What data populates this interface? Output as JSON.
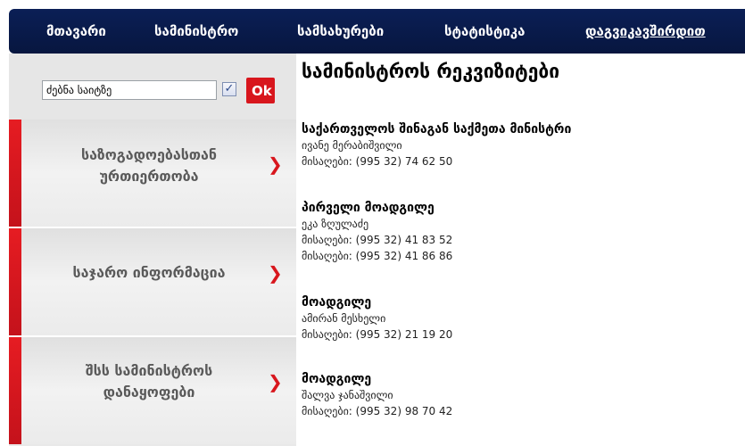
{
  "nav": {
    "items": [
      {
        "label": "მთავარი"
      },
      {
        "label": "სამინისტრო"
      },
      {
        "label": "სამსახურები"
      },
      {
        "label": "სტატისტიკა"
      },
      {
        "label": "დაგვიკავშირდით"
      }
    ]
  },
  "sidebar": {
    "search": {
      "value": "ძებნა საიტზე",
      "checkbox_glyph": "✓",
      "ok_label": "Ok"
    },
    "items": [
      {
        "label_line1": "საზოგადოებასთან",
        "label_line2": "ურთიერთობა"
      },
      {
        "label_line1": "საჯარო ინფორმაცია",
        "label_line2": ""
      },
      {
        "label_line1": "შსს სამინისტროს",
        "label_line2": "დანაყოფები"
      }
    ],
    "arrow_glyph": "❯"
  },
  "content": {
    "title": "სამინისტროს რეკვიზიტები",
    "entries": [
      {
        "role": "საქართველოს შინაგან საქმეთა მინისტრი",
        "name": "ივანე მერაბიშვილი",
        "phones": [
          "მისაღები: (995 32) 74 62 50"
        ]
      },
      {
        "role": "პირველი მოადგილე",
        "name": "ეკა ზღულაძე",
        "phones": [
          "მისაღები: (995 32) 41 83 52",
          "მისაღები: (995 32) 41 86 86"
        ]
      },
      {
        "role": "მოადგილე",
        "name": "ამირან მესხელი",
        "phones": [
          "მისაღები: (995 32) 21 19 20"
        ]
      },
      {
        "role": "მოადგილე",
        "name": "შალვა ჯანაშვილი",
        "phones": [
          "მისაღები: (995 32) 98 70 42"
        ]
      }
    ]
  },
  "colors": {
    "nav_bg": "#0b1f56",
    "accent_red": "#d8161d",
    "sidebar_bg": "#e9e9e9",
    "menu_text": "#5a5a5a"
  }
}
